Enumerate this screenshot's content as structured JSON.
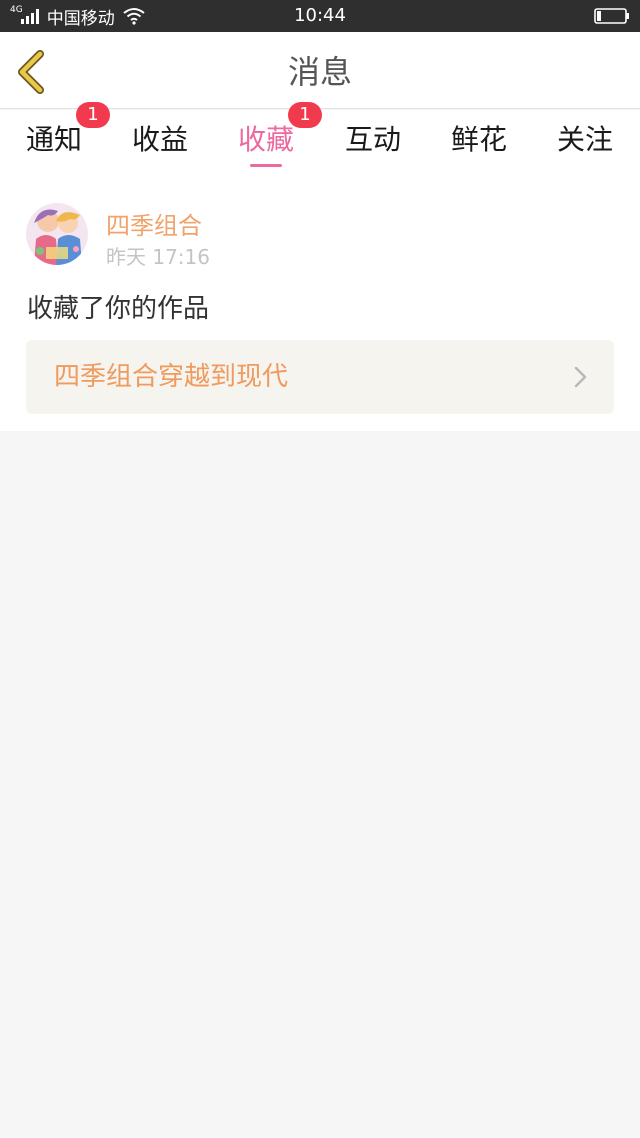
{
  "status_bar": {
    "network_label": "4G",
    "carrier": "中国移动",
    "time": "10:44",
    "icons": [
      "signal-icon",
      "wifi-icon",
      "battery-icon"
    ]
  },
  "header": {
    "title": "消息",
    "back_icon": "chevron-left-icon",
    "back_icon_color": "#e9c84a"
  },
  "tabs": [
    {
      "label": "通知",
      "badge": "1",
      "active": false
    },
    {
      "label": "收益",
      "badge": "",
      "active": false
    },
    {
      "label": "收藏",
      "badge": "1",
      "active": true
    },
    {
      "label": "互动",
      "badge": "",
      "active": false
    },
    {
      "label": "鲜花",
      "badge": "",
      "active": false
    },
    {
      "label": "关注",
      "badge": "",
      "active": false
    }
  ],
  "message": {
    "avatar_icon": "avatar-illustration",
    "username": "四季组合",
    "timestamp": "昨天 17:16",
    "text": "收藏了你的作品",
    "work_title": "四季组合穿越到现代",
    "link_icon": "chevron-right-icon"
  },
  "colors": {
    "accent_pink": "#ec6aa0",
    "username_orange": "#f0a36c",
    "link_orange": "#ef9a5e",
    "badge_red": "#f13a4e",
    "status_bar_bg": "#2f2f2f",
    "page_bg": "#f6f6f6"
  }
}
